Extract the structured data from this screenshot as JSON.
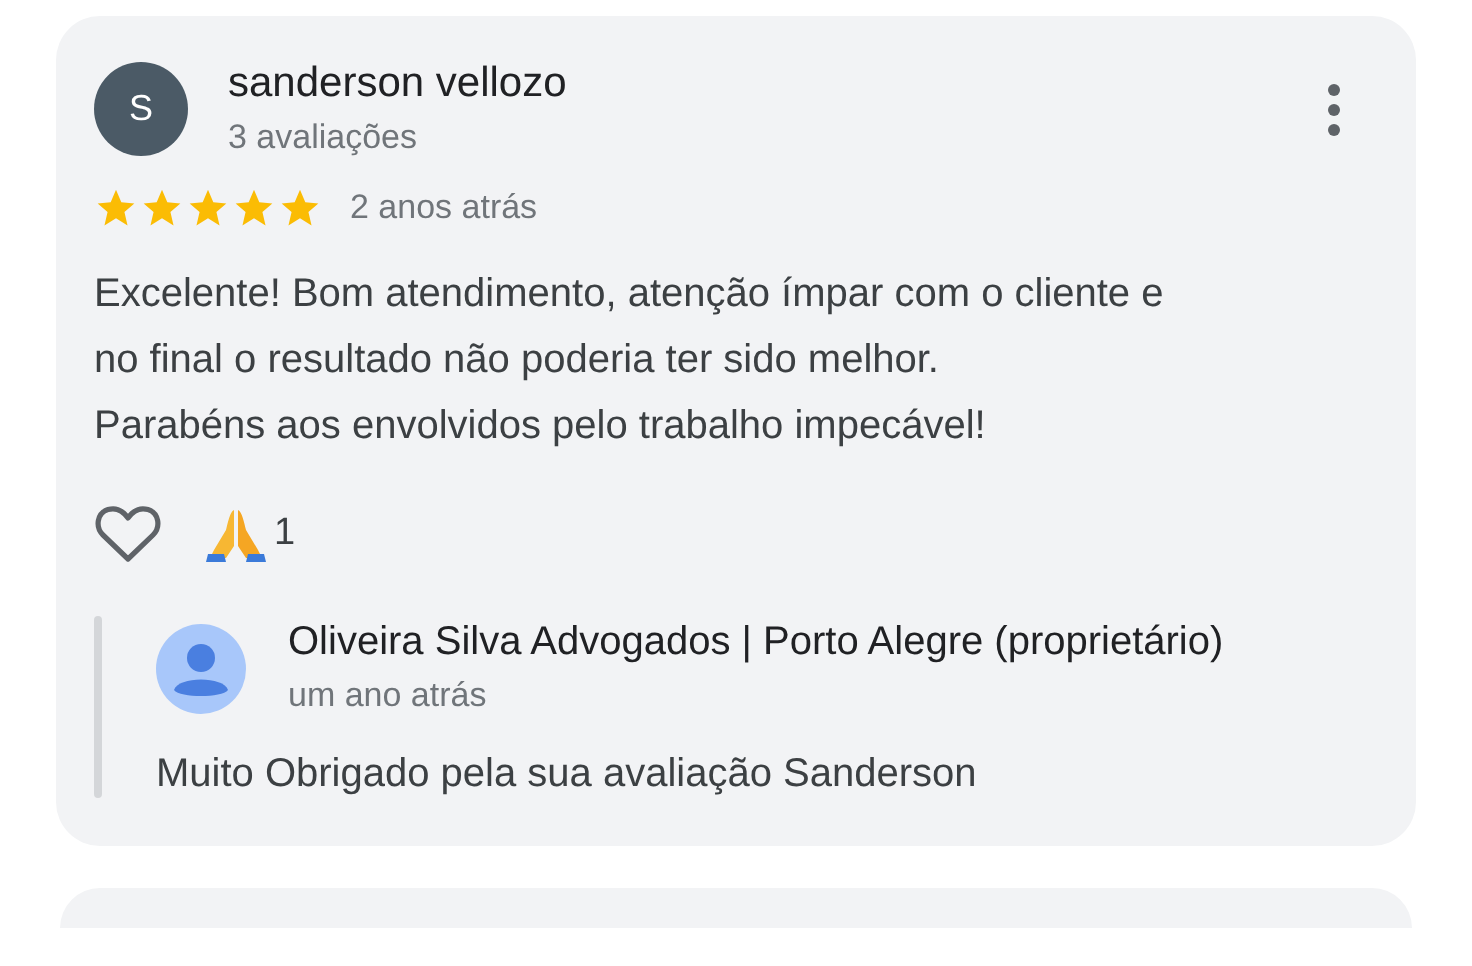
{
  "review": {
    "avatar_letter": "S",
    "author": "sanderson vellozo",
    "reviews_count": "3 avaliações",
    "stars": 5,
    "time": "2 anos atrás",
    "text_lines": [
      "Excelente! Bom atendimento, atenção ímpar com o cliente e",
      "no final o resultado não poderia ter sido melhor.",
      "Parabéns aos envolvidos pelo trabalho impecável!"
    ],
    "reaction_count": "1",
    "reply": {
      "author": "Oliveira Silva Advogados | Porto Alegre (proprietário)",
      "time": "um ano atrás",
      "text": "Muito Obrigado pela sua avaliação Sanderson"
    }
  }
}
